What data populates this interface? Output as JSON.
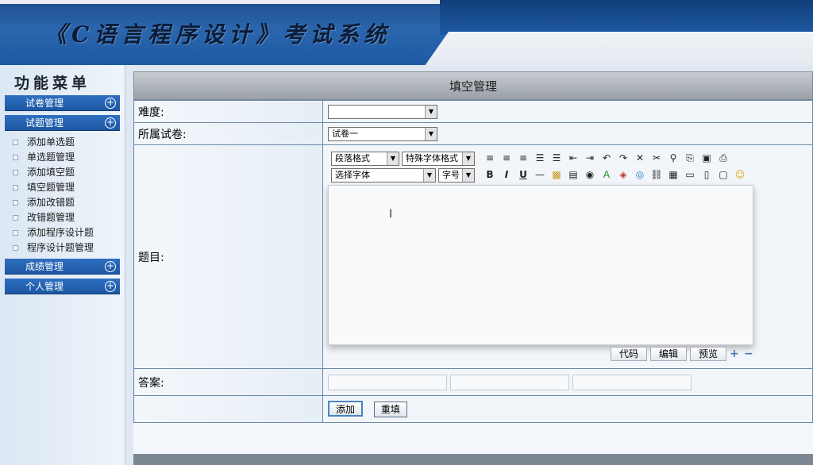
{
  "app": {
    "title": "《C语言程序设计》考试系统"
  },
  "sidebar": {
    "menu_title": "功能菜单",
    "groups": [
      {
        "label": "试卷管理"
      },
      {
        "label": "试题管理"
      },
      {
        "label": "成绩管理"
      },
      {
        "label": "个人管理"
      }
    ],
    "subitems": [
      {
        "label": "添加单选题"
      },
      {
        "label": "单选题管理"
      },
      {
        "label": "添加填空题"
      },
      {
        "label": "填空题管理"
      },
      {
        "label": "添加改错题"
      },
      {
        "label": "改错题管理"
      },
      {
        "label": "添加程序设计题"
      },
      {
        "label": "程序设计题管理"
      }
    ]
  },
  "main": {
    "panel_title": "填空管理",
    "fields": {
      "difficulty_label": "难度:",
      "difficulty_value": "",
      "paper_label": "所属试卷:",
      "paper_value": "试卷一",
      "question_label": "题目:",
      "answer_label": "答案:"
    },
    "editor": {
      "paragraph_format": "段落格式",
      "special_format": "特殊字体格式",
      "font_select": "选择字体",
      "font_size": "字号",
      "modes": [
        "代码",
        "编辑",
        "预览"
      ]
    },
    "buttons": {
      "add": "添加",
      "reset": "重填"
    }
  }
}
